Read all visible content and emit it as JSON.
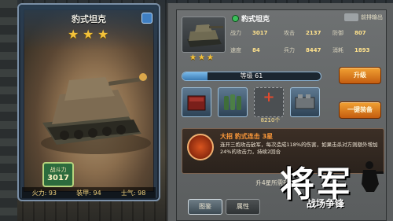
{
  "card": {
    "title": "豹式坦克",
    "stars": [
      "★",
      "★",
      "★"
    ],
    "power_label": "战斗力",
    "power_value": "3017",
    "stats": [
      "火力: 93",
      "装甲: 94",
      "士气: 98"
    ]
  },
  "unit": {
    "name": "豹式坦克",
    "front_output_label": "前排输出",
    "thumb_stars": [
      "★",
      "★",
      "★"
    ],
    "stats": [
      {
        "label": "战力",
        "value": "3017"
      },
      {
        "label": "攻击",
        "value": "2137"
      },
      {
        "label": "防御",
        "value": "807"
      },
      {
        "label": "速度",
        "value": "84"
      },
      {
        "label": "兵力",
        "value": "8447"
      },
      {
        "label": "消耗",
        "value": "1893"
      }
    ],
    "level_text": "等级 61",
    "level_progress": 0.18
  },
  "buttons": {
    "upgrade": "升级",
    "equip_all": "一键装备"
  },
  "equipment": {
    "fuel_count": "8210个"
  },
  "skill": {
    "title": "大招 豹式连击 3星",
    "description": "连开三炮攻击敌军，每次造成118%的伤害，如果击杀对方则额外增加24%的攻击力，持续2回合"
  },
  "fragments": {
    "text": "升4星所需碎片（1/1"
  },
  "tabs": {
    "tujian": "图鉴",
    "shuxing": "属性"
  },
  "logo": {
    "main": "将军",
    "sub": "战场争锋"
  }
}
